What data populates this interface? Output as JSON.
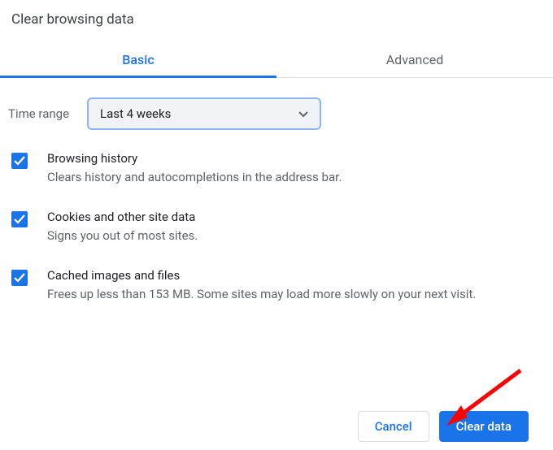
{
  "title": "Clear browsing data",
  "tabs": {
    "basic": "Basic",
    "advanced": "Advanced",
    "active": "basic"
  },
  "time_range": {
    "label": "Time range",
    "value": "Last 4 weeks"
  },
  "options": [
    {
      "checked": true,
      "title": "Browsing history",
      "desc": "Clears history and autocompletions in the address bar."
    },
    {
      "checked": true,
      "title": "Cookies and other site data",
      "desc": "Signs you out of most sites."
    },
    {
      "checked": true,
      "title": "Cached images and files",
      "desc": "Frees up less than 153 MB. Some sites may load more slowly on your next visit."
    }
  ],
  "buttons": {
    "cancel": "Cancel",
    "clear": "Clear data"
  },
  "colors": {
    "primary": "#1a73e8",
    "text_secondary": "#5f6368",
    "annotation_arrow": "#ff0000"
  }
}
